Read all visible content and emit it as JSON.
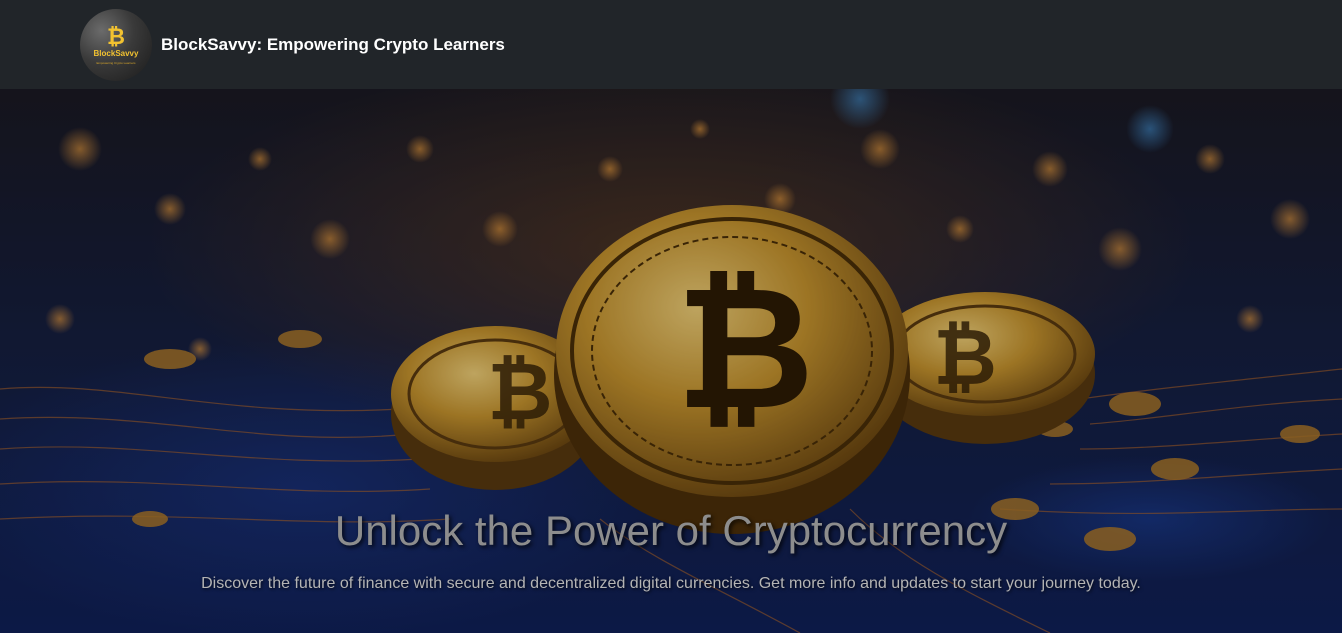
{
  "navbar": {
    "logo": {
      "text": "BlockSavvy",
      "tagline": "Empowering Crypto Learners",
      "icon": "bitcoin-icon"
    },
    "brand_title": "BlockSavvy: Empowering Crypto Learners"
  },
  "hero": {
    "heading": "Unlock the Power of Cryptocurrency",
    "subtext": "Discover the future of finance with secure and decentralized digital currencies. Get more info and updates to start your journey today.",
    "background_image": "bitcoin-coins-on-circuit-board"
  },
  "colors": {
    "navbar_bg": "#212529",
    "gold_accent": "#f2c230",
    "heading_text": "#8d8d8d"
  }
}
